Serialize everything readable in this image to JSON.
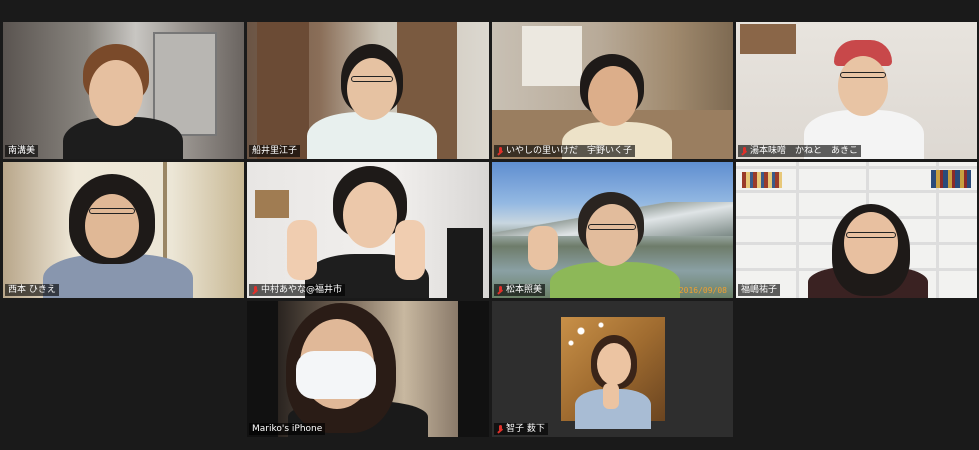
{
  "app": {
    "background": "#1a1a1a",
    "active_speaker_color": "#d8e85a",
    "muted_icon_color": "#e0302a"
  },
  "participants": [
    {
      "name": "南溝美",
      "muted": false
    },
    {
      "name": "船井里江子",
      "muted": false,
      "active": true
    },
    {
      "name": "いやしの里いけだ　宇野いく子",
      "muted": true
    },
    {
      "name": "湯本味噌　かねと　あきこ",
      "muted": true
    },
    {
      "name": "西本 ひきえ",
      "muted": false
    },
    {
      "name": "中村あやな@福井市",
      "muted": true
    },
    {
      "name": "松本照美",
      "muted": true,
      "date_stamp": "2016/09/08"
    },
    {
      "name": "福嶋祐子",
      "muted": false
    },
    {
      "name": "Mariko's iPhone",
      "muted": false
    },
    {
      "name": "智子 薮下",
      "muted": true
    }
  ]
}
